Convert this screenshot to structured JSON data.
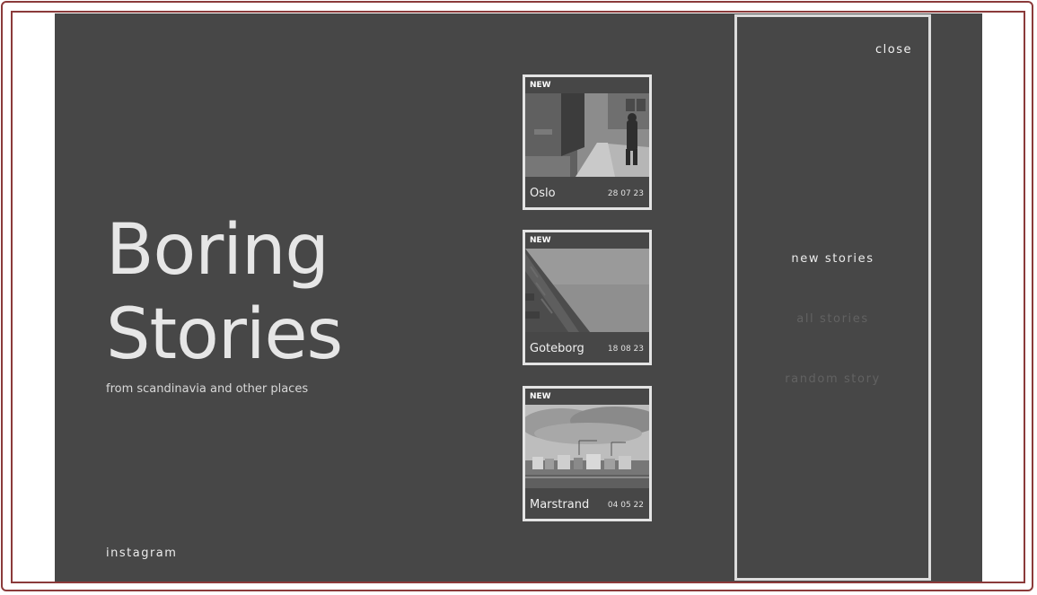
{
  "hero": {
    "title_line1": "Boring",
    "title_line2": "Stories",
    "subtitle": "from scandinavia and other places"
  },
  "footer": {
    "instagram_label": "instagram"
  },
  "stories": [
    {
      "badge": "NEW",
      "name": "Oslo",
      "date": "28 07 23",
      "photo_icon": "street-photo"
    },
    {
      "badge": "NEW",
      "name": "Goteborg",
      "date": "18 08 23",
      "photo_icon": "building-sky-photo"
    },
    {
      "badge": "NEW",
      "name": "Marstrand",
      "date": "04 05 22",
      "photo_icon": "waterfront-photo"
    }
  ],
  "menu": {
    "close_label": "close",
    "items": [
      {
        "label": "new stories",
        "state": "active"
      },
      {
        "label": "all stories",
        "state": "dim"
      },
      {
        "label": "random story",
        "state": "dim"
      }
    ]
  },
  "colors": {
    "background": "#474747",
    "text": "#e6e6e6",
    "dim_text": "#626262",
    "frame": "#8b3a3a"
  }
}
